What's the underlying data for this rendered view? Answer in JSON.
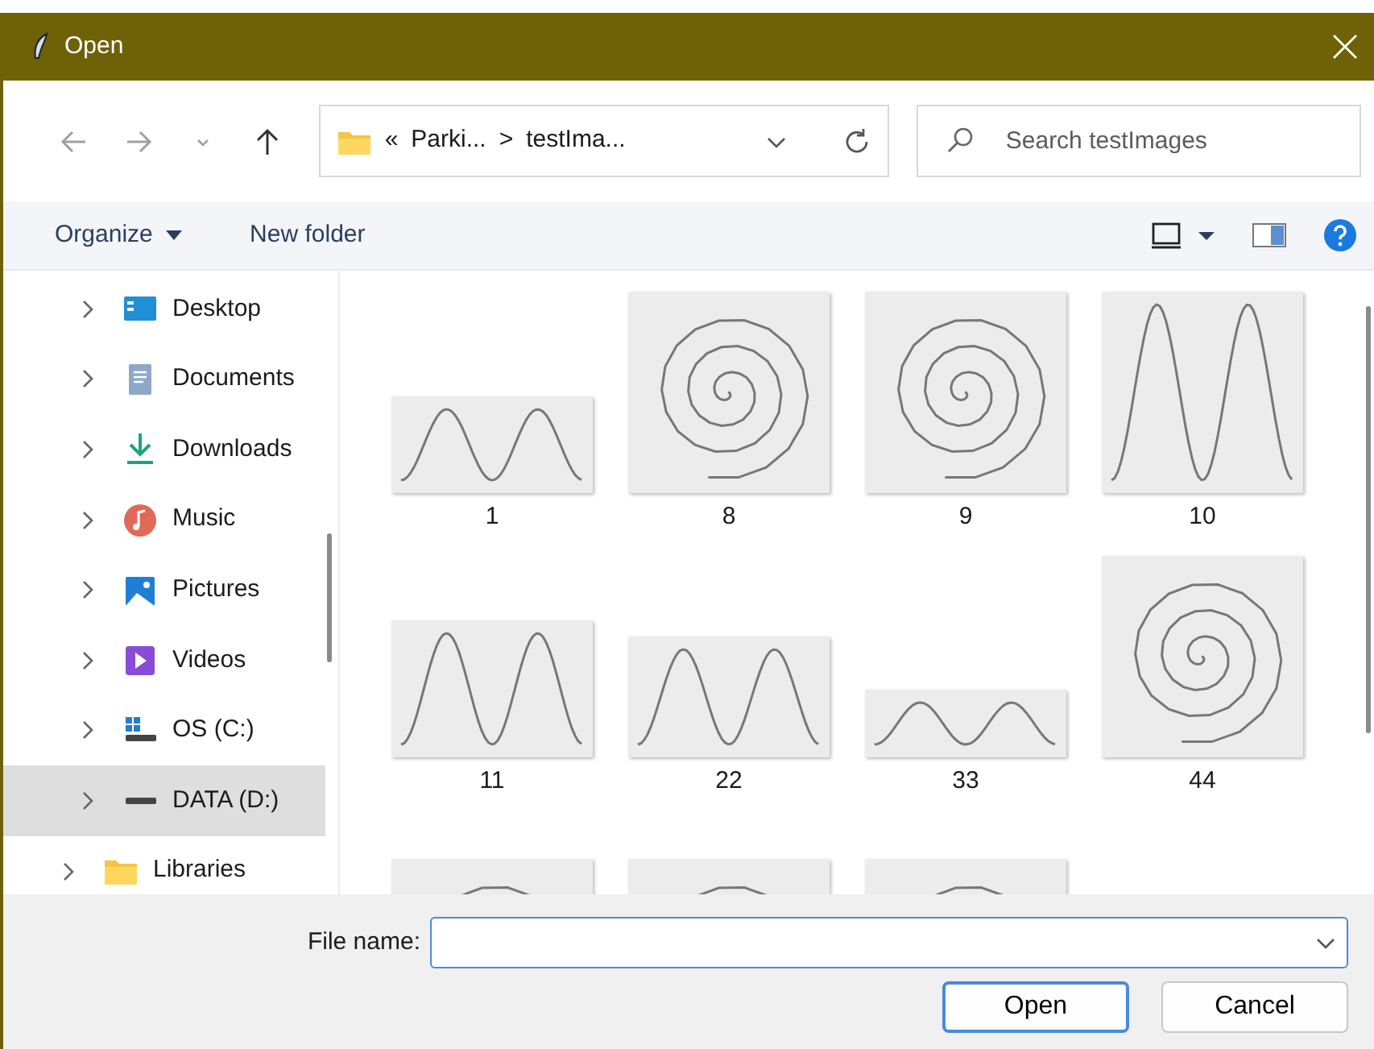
{
  "window": {
    "title": "Open"
  },
  "address": {
    "overflow": "«",
    "crumbs": [
      "Parki...",
      "testIma..."
    ],
    "separator": ">"
  },
  "search": {
    "placeholder": "Search testImages"
  },
  "toolbar": {
    "organize": "Organize",
    "new_folder": "New folder"
  },
  "sidebar": {
    "tree": [
      {
        "children": [
          {
            "label": "Desktop",
            "selected": false
          },
          {
            "label": "Documents",
            "selected": false
          },
          {
            "label": "Downloads",
            "selected": false
          },
          {
            "label": "Music",
            "selected": false
          },
          {
            "label": "Pictures",
            "selected": false
          },
          {
            "label": "Videos",
            "selected": false
          },
          {
            "label": "OS (C:)",
            "selected": false
          },
          {
            "label": "DATA (D:)",
            "selected": true
          }
        ]
      },
      {
        "label": "Libraries",
        "selected": false
      }
    ]
  },
  "files": [
    {
      "name": "1",
      "kind": "picture"
    },
    {
      "name": "8",
      "kind": "picture"
    },
    {
      "name": "9",
      "kind": "picture"
    },
    {
      "name": "10",
      "kind": "picture"
    },
    {
      "name": "11",
      "kind": "picture"
    },
    {
      "name": "22",
      "kind": "picture"
    },
    {
      "name": "33",
      "kind": "picture"
    },
    {
      "name": "44",
      "kind": "picture"
    },
    {
      "kind": "picture"
    },
    {
      "kind": "picture"
    },
    {
      "kind": "picture"
    }
  ],
  "file_name": {
    "label": "File name:"
  },
  "buttons": [
    {
      "label": "Open",
      "default": true
    },
    {
      "label": "Cancel",
      "default": false
    }
  ]
}
